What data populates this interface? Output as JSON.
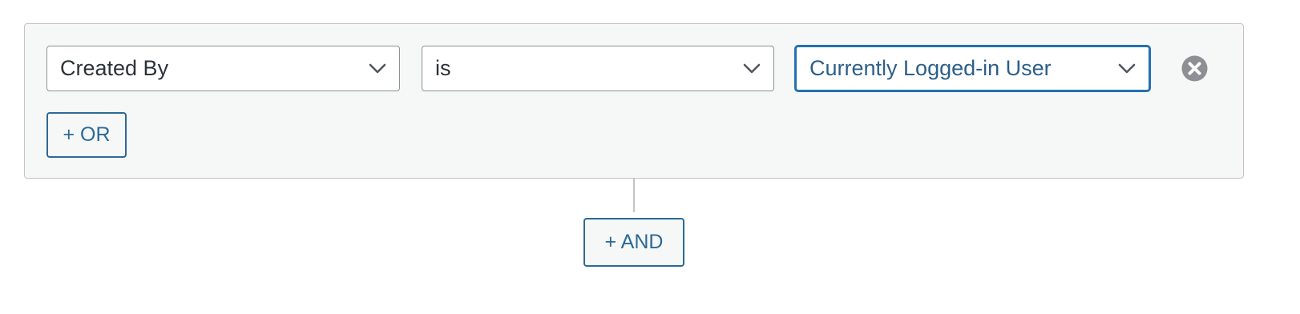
{
  "condition_group": {
    "field_select": {
      "value": "Created By",
      "icon": "chevron-down-icon"
    },
    "operator_select": {
      "value": "is",
      "icon": "chevron-down-icon"
    },
    "value_select": {
      "value": "Currently Logged-in User",
      "icon": "chevron-down-icon",
      "focused": true
    },
    "remove_icon": "close-circle-icon",
    "or_button_label": "+ OR"
  },
  "and_button_label": "+ AND",
  "colors": {
    "accent": "#2271b1",
    "button_text": "#2c6a96",
    "group_bg": "#f6f7f7",
    "border": "#c3c4c7",
    "remove_icon": "#8c8f94"
  }
}
